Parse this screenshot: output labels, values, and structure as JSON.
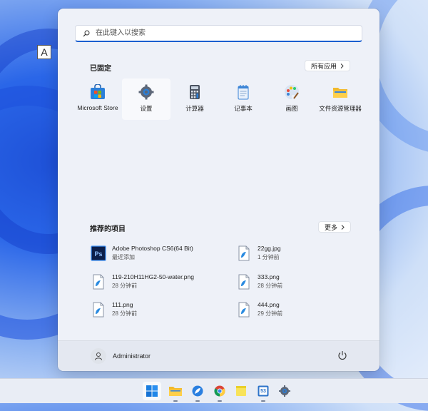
{
  "search": {
    "placeholder": "在此键入以搜索"
  },
  "keyboard_hint": "A",
  "pinned": {
    "title": "已固定",
    "all_apps_label": "所有应用",
    "apps": [
      {
        "label": "Microsoft Store",
        "icon": "store-icon"
      },
      {
        "label": "设置",
        "icon": "settings-gear-icon"
      },
      {
        "label": "计算器",
        "icon": "calculator-icon"
      },
      {
        "label": "记事本",
        "icon": "notepad-icon"
      },
      {
        "label": "画图",
        "icon": "paint-icon"
      },
      {
        "label": "文件资源管理器",
        "icon": "folder-icon"
      }
    ]
  },
  "recommended": {
    "title": "推荐的项目",
    "more_label": "更多",
    "items": [
      {
        "name": "Adobe Photoshop CS6(64 Bit)",
        "time": "最近添加",
        "icon": "photoshop-icon"
      },
      {
        "name": "22gg.jpg",
        "time": "1 分钟前",
        "icon": "image-file-icon"
      },
      {
        "name": "119-210H11HG2-50-water.png",
        "time": "28 分钟前",
        "icon": "image-file-icon"
      },
      {
        "name": "333.png",
        "time": "28 分钟前",
        "icon": "image-file-icon"
      },
      {
        "name": "111.png",
        "time": "28 分钟前",
        "icon": "image-file-icon"
      },
      {
        "name": "444.png",
        "time": "29 分钟前",
        "icon": "image-file-icon"
      }
    ]
  },
  "user": {
    "name": "Administrator"
  },
  "taskbar": {
    "items": [
      "start-icon",
      "file-explorer-icon",
      "feather-app-icon",
      "chrome-icon",
      "sticky-notes-icon",
      "app-53-icon",
      "settings-icon"
    ],
    "app_53_label": "53"
  },
  "colors": {
    "accent": "#1a5fd0",
    "menu_bg": "#eef1f8"
  }
}
